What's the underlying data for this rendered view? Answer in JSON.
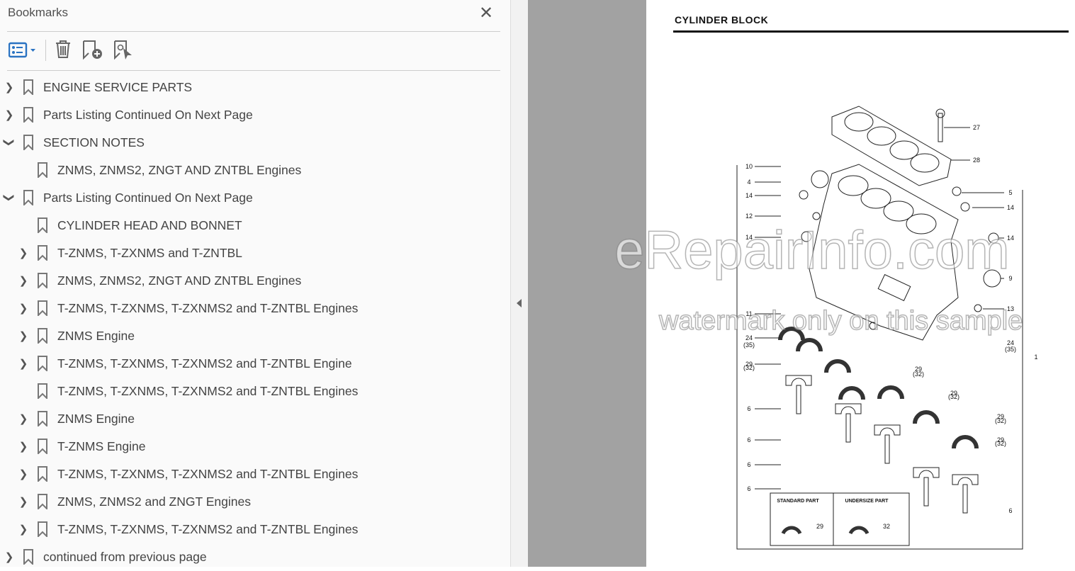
{
  "panel": {
    "title": "Bookmarks",
    "close_icon": "close-icon",
    "toolbar": {
      "options_icon": "list-options-icon",
      "delete_icon": "trash-icon",
      "new_bookmark_icon": "bookmark-add-icon",
      "bookmark_target_icon": "bookmark-target-icon",
      "accent": "#2a73c2"
    },
    "items": [
      {
        "label": "ENGINE SERVICE PARTS",
        "level": 0,
        "state": "collapsed"
      },
      {
        "label": "Parts Listing Continued On Next Page",
        "level": 0,
        "state": "collapsed"
      },
      {
        "label": "SECTION NOTES",
        "level": 0,
        "state": "expanded"
      },
      {
        "label": "ZNMS, ZNMS2, ZNGT AND ZNTBL Engines",
        "level": 1,
        "state": "leaf"
      },
      {
        "label": "Parts Listing Continued On Next Page",
        "level": 0,
        "state": "expanded"
      },
      {
        "label": "CYLINDER HEAD AND BONNET",
        "level": 1,
        "state": "leaf"
      },
      {
        "label": "T-ZNMS, T-ZXNMS and T-ZNTBL",
        "level": 1,
        "state": "collapsed"
      },
      {
        "label": "ZNMS, ZNMS2, ZNGT AND ZNTBL Engines",
        "level": 1,
        "state": "collapsed"
      },
      {
        "label": "T-ZNMS, T-ZXNMS, T-ZXNMS2 and T-ZNTBL Engines",
        "level": 1,
        "state": "collapsed"
      },
      {
        "label": "ZNMS Engine",
        "level": 1,
        "state": "collapsed"
      },
      {
        "label": "T-ZNMS, T-ZXNMS, T-ZXNMS2 and T-ZNTBL Engine",
        "level": 1,
        "state": "collapsed"
      },
      {
        "label": "T-ZNMS, T-ZXNMS, T-ZXNMS2 and T-ZNTBL Engines",
        "level": 1,
        "state": "leaf"
      },
      {
        "label": "ZNMS Engine",
        "level": 1,
        "state": "collapsed"
      },
      {
        "label": "T-ZNMS Engine",
        "level": 1,
        "state": "collapsed"
      },
      {
        "label": "T-ZNMS, T-ZXNMS, T-ZXNMS2 and T-ZNTBL Engines",
        "level": 1,
        "state": "collapsed"
      },
      {
        "label": "ZNMS, ZNMS2 and ZNGT Engines",
        "level": 1,
        "state": "collapsed"
      },
      {
        "label": "T-ZNMS, T-ZXNMS, T-ZXNMS2 and T-ZNTBL Engines",
        "level": 1,
        "state": "collapsed"
      },
      {
        "label": "continued from previous page",
        "level": 0,
        "state": "collapsed"
      }
    ]
  },
  "document": {
    "page_title": "CYLINDER BLOCK",
    "watermark_line1": "eRepairInfo.com",
    "watermark_line2": "watermark only on this sample",
    "callouts_left": [
      "10",
      "4",
      "14",
      "12",
      "14",
      "11",
      "24",
      "(35)",
      "29",
      "(32)",
      "6",
      "6",
      "6",
      "6"
    ],
    "callouts_right": [
      "27",
      "28",
      "5",
      "14",
      "14",
      "9",
      "13",
      "24",
      "(35)",
      "1",
      "29",
      "(32)",
      "29",
      "(32)",
      "29",
      "(32)",
      "29",
      "(32)",
      "6"
    ],
    "legend": {
      "standard_label": "STANDARD PART",
      "standard_num": "29",
      "undersize_label": "UNDERSIZE PART",
      "undersize_num": "32"
    }
  }
}
